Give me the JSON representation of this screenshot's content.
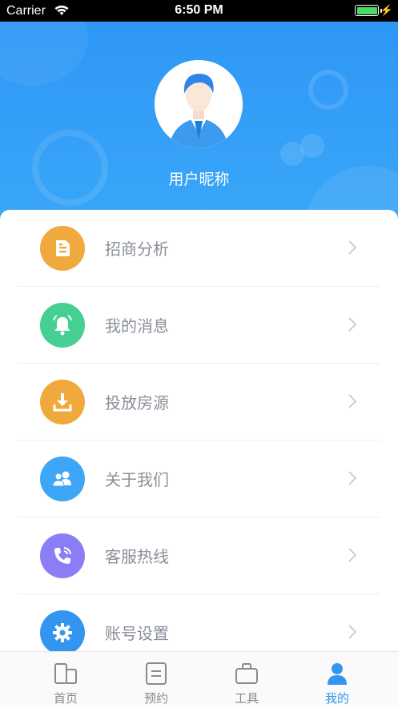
{
  "status_bar": {
    "carrier": "Carrier",
    "time": "6:50 PM",
    "battery_level": 1.0
  },
  "profile": {
    "nickname": "用户昵称"
  },
  "menu": [
    {
      "label": "招商分析",
      "icon": "document-icon",
      "color": "#f0a93c"
    },
    {
      "label": "我的消息",
      "icon": "bell-icon",
      "color": "#45cf93"
    },
    {
      "label": "投放房源",
      "icon": "download-icon",
      "color": "#f0a93c"
    },
    {
      "label": "关于我们",
      "icon": "people-icon",
      "color": "#3ea6f6"
    },
    {
      "label": "客服热线",
      "icon": "phone-icon",
      "color": "#8b7df5"
    },
    {
      "label": "账号设置",
      "icon": "gear-icon",
      "color": "#3296f0"
    }
  ],
  "tabs": [
    {
      "label": "首页",
      "icon": "home-icon",
      "active": false
    },
    {
      "label": "预约",
      "icon": "appointment-icon",
      "active": false
    },
    {
      "label": "工具",
      "icon": "toolbox-icon",
      "active": false
    },
    {
      "label": "我的",
      "icon": "profile-icon",
      "active": true
    }
  ],
  "colors": {
    "header": "#2e97f6",
    "active_tab": "#3296f0",
    "inactive_tab": "#8a8a8a",
    "label": "#8a8f99"
  }
}
